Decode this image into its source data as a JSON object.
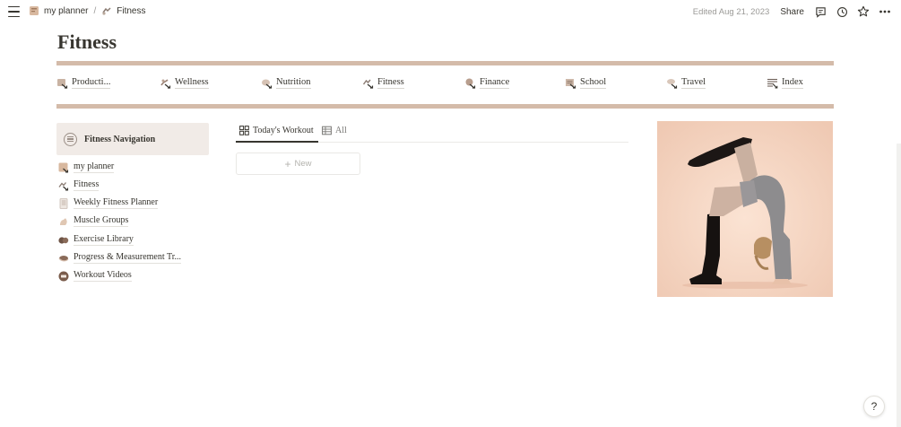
{
  "breadcrumb": {
    "items": [
      {
        "label": "my planner",
        "icon": "planner-icon"
      },
      {
        "label": "Fitness",
        "icon": "fitness-icon"
      }
    ],
    "separator": "/"
  },
  "topbar": {
    "edited": "Edited Aug 21, 2023",
    "share_label": "Share",
    "icons": [
      "comment-icon",
      "history-icon",
      "star-icon",
      "more-icon"
    ]
  },
  "page": {
    "title": "Fitness"
  },
  "nav_strip": {
    "items": [
      {
        "label": "Producti...",
        "icon": "productivity-icon"
      },
      {
        "label": "Wellness",
        "icon": "wellness-icon"
      },
      {
        "label": "Nutrition",
        "icon": "nutrition-icon"
      },
      {
        "label": "Fitness",
        "icon": "fitness-icon"
      },
      {
        "label": "Finance",
        "icon": "finance-icon"
      },
      {
        "label": "School",
        "icon": "school-icon"
      },
      {
        "label": "Travel",
        "icon": "travel-icon"
      },
      {
        "label": "Index",
        "icon": "index-icon"
      }
    ]
  },
  "fitness_nav": {
    "title": "Fitness Navigation",
    "items": [
      {
        "label": "my planner",
        "icon": "planner-icon"
      },
      {
        "label": "Fitness",
        "icon": "fitness-icon"
      },
      {
        "label": "Weekly Fitness Planner",
        "icon": "notebook-icon"
      },
      {
        "label": "Muscle Groups",
        "icon": "muscle-icon"
      },
      {
        "label": "Exercise Library",
        "icon": "dumbbell-icon"
      },
      {
        "label": "Progress & Measurement Tr...",
        "icon": "tape-icon"
      },
      {
        "label": "Workout Videos",
        "icon": "video-icon"
      }
    ]
  },
  "database": {
    "tabs": [
      {
        "label": "Today's Workout",
        "icon": "gallery-icon",
        "active": true
      },
      {
        "label": "All",
        "icon": "table-icon",
        "active": false
      }
    ],
    "new_label": "New"
  },
  "colors": {
    "divider": "#d4bba9",
    "callout_bg": "#f1ebe7",
    "image_bg": "#f3d9c9"
  },
  "help_label": "?"
}
